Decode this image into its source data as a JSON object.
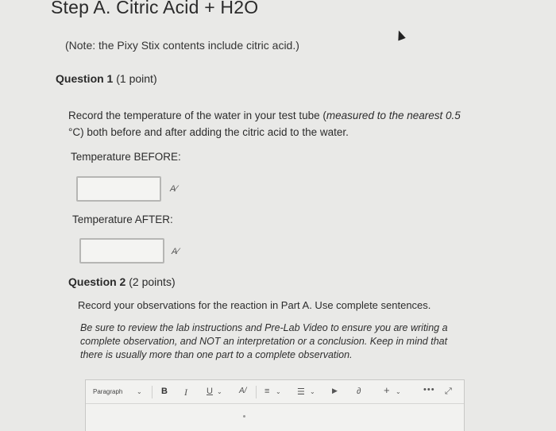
{
  "title": "Step A. Citric Acid + H2O",
  "note": "(Note: the Pixy Stix contents include citric acid.)",
  "question1": {
    "label": "Question 1",
    "points": "(1 point)",
    "text_part1": "Record the temperature of the water in your test tube (",
    "text_italic": "measured to the nearest 0.5",
    "text_part2": "°C) both before and after adding the citric acid to the water.",
    "before_label": "Temperature BEFORE:",
    "after_label": "Temperature AFTER:",
    "before_value": "",
    "after_value": ""
  },
  "question2": {
    "label": "Question 2",
    "points": "(2 points)",
    "prompt": "Record your observations for the reaction in Part A. Use complete sentences.",
    "instructions": "Be sure to review the lab instructions and Pre-Lab Video to ensure you are writing a complete observation, and NOT an interpretation or a conclusion. Keep in mind that there is usually more than one part to a complete observation."
  },
  "toolbar": {
    "paragraph": "Paragraph",
    "bold": "B",
    "italic": "I",
    "underline": "U",
    "spellcheck": "A/",
    "align": "≡",
    "list": "☰",
    "media": "▶",
    "link": "∂",
    "insert": "+",
    "more": "•••",
    "fullscreen": "⤢"
  },
  "icons": {
    "spellcheck_icon": "spellcheck-icon",
    "cursor": "mouse-cursor"
  }
}
